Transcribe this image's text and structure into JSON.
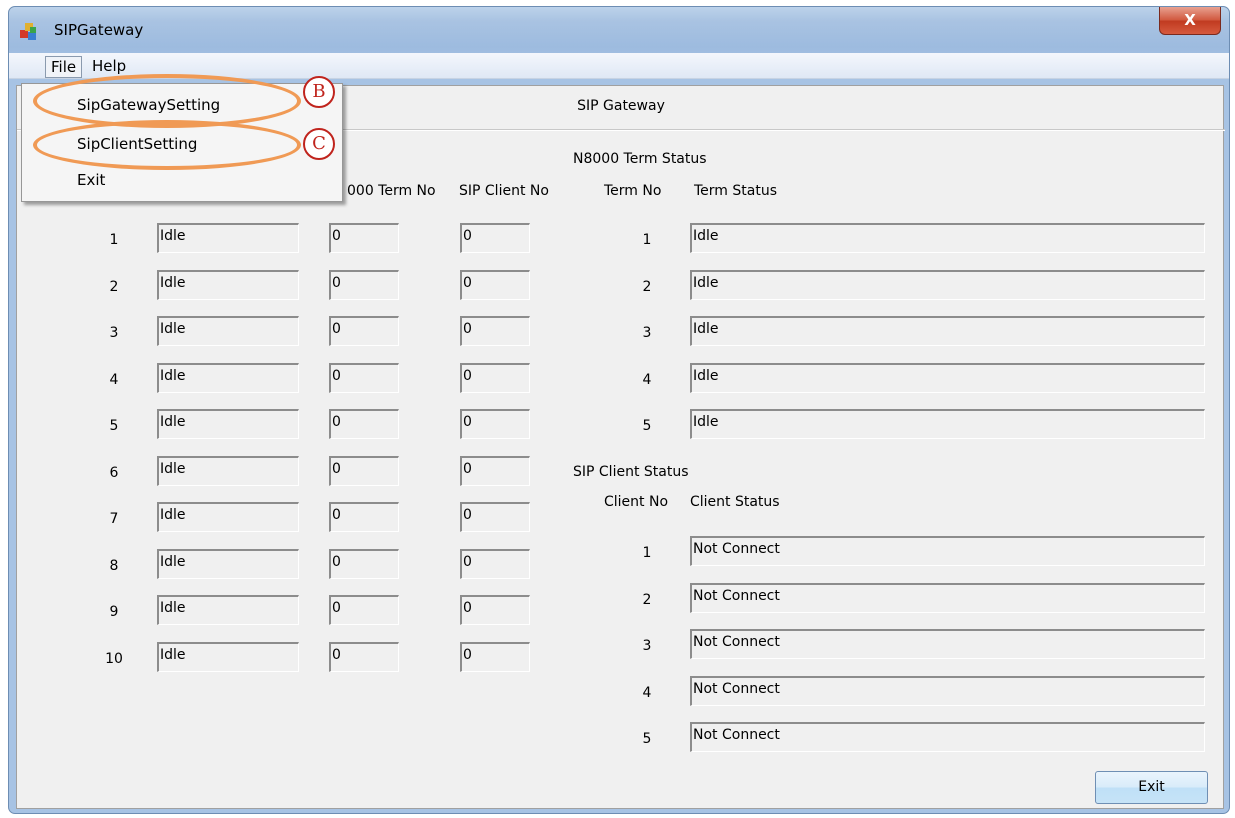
{
  "window": {
    "title": "SIPGateway",
    "close_label": "X"
  },
  "menubar": {
    "file": "File",
    "help": "Help"
  },
  "file_menu": {
    "items": [
      "SipGatewaySetting",
      "SipClientSetting",
      "Exit"
    ]
  },
  "annotations": {
    "b": "B",
    "c": "C",
    "ring_color": "#f09a55",
    "badge_color": "#c0241d"
  },
  "main": {
    "header_title": "SIP Gateway",
    "left_headers": {
      "term_no_fragment": "000 Term No",
      "sip_client_no": "SIP Client No"
    },
    "left_rows": [
      {
        "no": "1",
        "status": "Idle",
        "term": "0",
        "client": "0"
      },
      {
        "no": "2",
        "status": "Idle",
        "term": "0",
        "client": "0"
      },
      {
        "no": "3",
        "status": "Idle",
        "term": "0",
        "client": "0"
      },
      {
        "no": "4",
        "status": "Idle",
        "term": "0",
        "client": "0"
      },
      {
        "no": "5",
        "status": "Idle",
        "term": "0",
        "client": "0"
      },
      {
        "no": "6",
        "status": "Idle",
        "term": "0",
        "client": "0"
      },
      {
        "no": "7",
        "status": "Idle",
        "term": "0",
        "client": "0"
      },
      {
        "no": "8",
        "status": "Idle",
        "term": "0",
        "client": "0"
      },
      {
        "no": "9",
        "status": "Idle",
        "term": "0",
        "client": "0"
      },
      {
        "no": "10",
        "status": "Idle",
        "term": "0",
        "client": "0"
      }
    ],
    "term_status": {
      "title": "N8000 Term Status",
      "col_no": "Term No",
      "col_status": "Term Status",
      "rows": [
        {
          "no": "1",
          "status": "Idle"
        },
        {
          "no": "2",
          "status": "Idle"
        },
        {
          "no": "3",
          "status": "Idle"
        },
        {
          "no": "4",
          "status": "Idle"
        },
        {
          "no": "5",
          "status": "Idle"
        }
      ]
    },
    "client_status": {
      "title": "SIP Client Status",
      "col_no": "Client No",
      "col_status": "Client Status",
      "rows": [
        {
          "no": "1",
          "status": "Not Connect"
        },
        {
          "no": "2",
          "status": "Not Connect"
        },
        {
          "no": "3",
          "status": "Not Connect"
        },
        {
          "no": "4",
          "status": "Not Connect"
        },
        {
          "no": "5",
          "status": "Not Connect"
        }
      ]
    },
    "exit_label": "Exit"
  }
}
